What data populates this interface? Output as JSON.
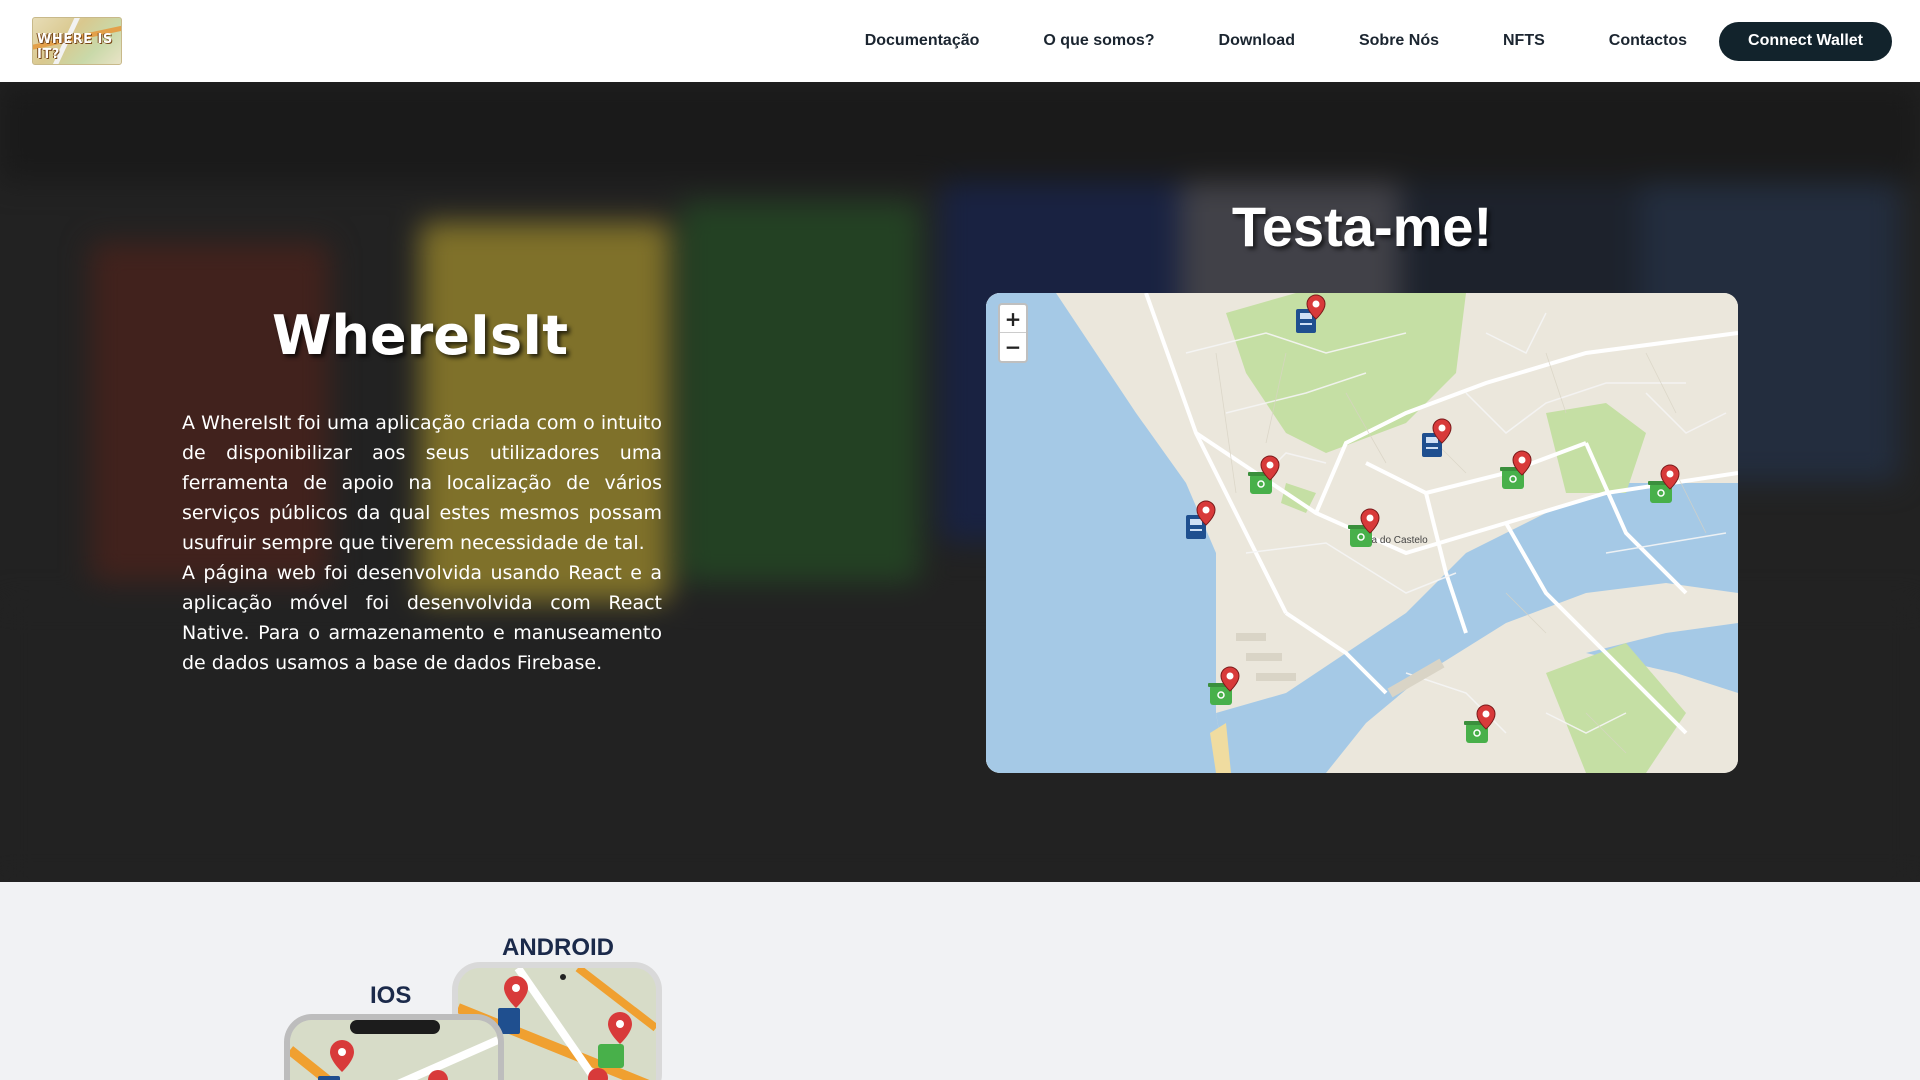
{
  "header": {
    "logo_text": "WHERE IS IT?",
    "nav": [
      {
        "label": "Documentação"
      },
      {
        "label": "O que somos?"
      },
      {
        "label": "Download"
      },
      {
        "label": "Sobre Nós"
      },
      {
        "label": "NFTS"
      },
      {
        "label": "Contactos"
      }
    ],
    "wallet_button": "Connect Wallet"
  },
  "hero": {
    "title": "WhereIsIt",
    "paragraph1": "A WhereIsIt foi uma aplicação criada com o intuito de disponibilizar aos seus utilizadores uma ferramenta de apoio na localização de vários serviços públicos da qual estes mesmos possam usufruir sempre que tiverem necessidade de tal.",
    "paragraph2": "A página web foi desenvolvida usando React e a aplicação móvel foi desenvolvida com React Native. Para o armazenamento e manuseamento de dados usamos a base de dados Firebase.",
    "map_title": "Testa-me!",
    "map": {
      "zoom_in": "+",
      "zoom_out": "−",
      "place_label": "na do Castelo",
      "markers": [
        {
          "type": "atm-icon"
        },
        {
          "type": "atm-icon"
        },
        {
          "type": "recycling-bin-icon"
        },
        {
          "type": "atm-icon"
        },
        {
          "type": "recycling-bin-icon"
        },
        {
          "type": "recycling-bin-icon"
        },
        {
          "type": "recycling-bin-icon"
        },
        {
          "type": "recycling-bin-icon"
        },
        {
          "type": "recycling-bin-icon"
        }
      ]
    }
  },
  "download": {
    "android_label": "ANDROID",
    "ios_label": "IOS"
  },
  "colors": {
    "header_bg": "#ffffff",
    "wallet_button_bg": "#12232c",
    "nav_text": "#1b2530",
    "water": "#a5c9e6",
    "park": "#c5dfa4",
    "marker_red": "#d83a3a",
    "bin_green": "#48b04a",
    "atm_blue": "#1f4f8f"
  }
}
